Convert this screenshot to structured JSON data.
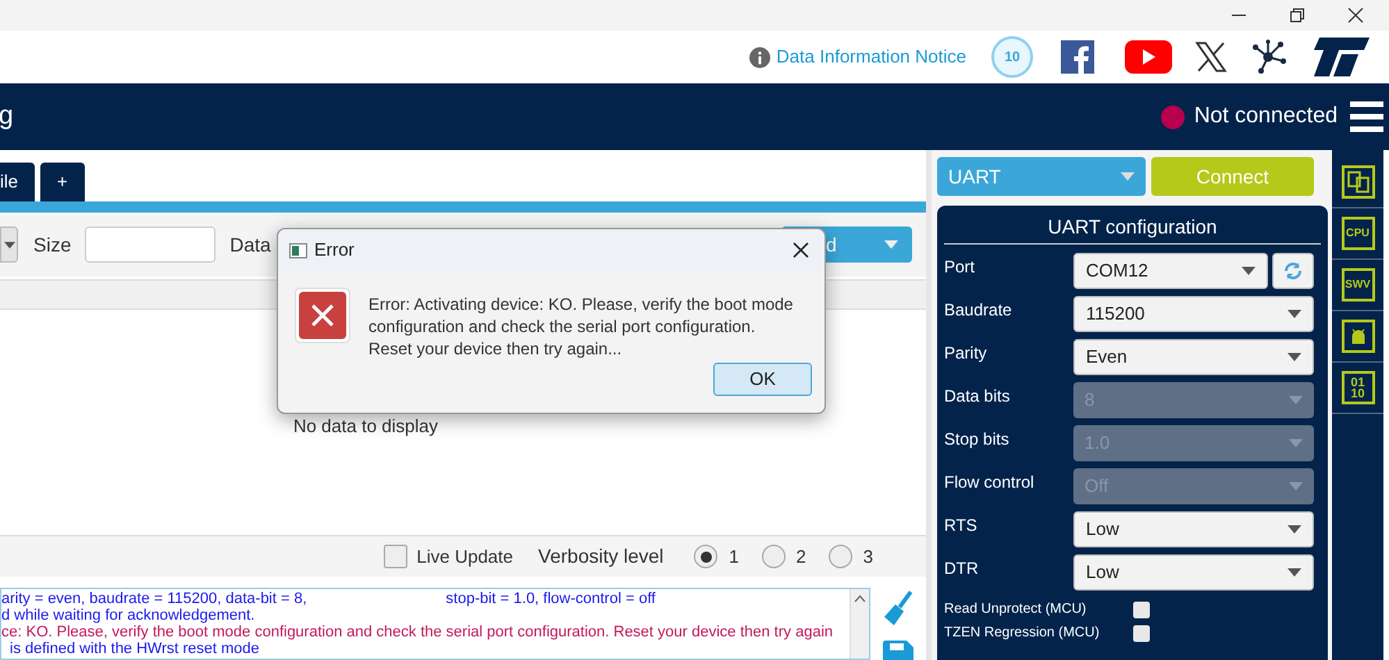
{
  "header": {
    "info_link": "Data Information Notice",
    "anniversary_badge": "10"
  },
  "appbar": {
    "title": "g",
    "status": "Not connected",
    "connected": false
  },
  "tabs": [
    {
      "label": "ile",
      "selected": false
    },
    {
      "label": "+",
      "selected": false
    }
  ],
  "toolbar": {
    "size_label": "Size",
    "data_label": "Data",
    "read_button": "d"
  },
  "table": {
    "empty": "No data to display"
  },
  "dialog": {
    "title": "Error",
    "message": "Error: Activating device: KO. Please, verify the boot mode configuration and check the serial port configuration. Reset your device then try again...",
    "ok": "OK"
  },
  "log_controls": {
    "live_update": {
      "label": "Live Update",
      "checked": false
    },
    "verbosity_label": "Verbosity level",
    "levels": [
      {
        "label": "1",
        "selected": true
      },
      {
        "label": "2",
        "selected": false
      },
      {
        "label": "3",
        "selected": false
      }
    ]
  },
  "log": [
    {
      "kind": "info",
      "text": "arity = even, baudrate = 115200, data-bit = 8,",
      "text_2": "stop-bit = 1.0, flow-control = off"
    },
    {
      "kind": "info",
      "text": "d while waiting for acknowledgement."
    },
    {
      "kind": "error",
      "text": "ce: KO. Please, verify the boot mode configuration and check the serial port configuration. Reset your device then try again"
    },
    {
      "kind": "info",
      "text": "is defined with the HWrst reset mode"
    }
  ],
  "connection": {
    "interface": "UART",
    "connect": "Connect"
  },
  "config": {
    "title": "UART configuration",
    "fields": [
      {
        "label": "Port",
        "value": "COM12",
        "disabled": false,
        "refresh": true
      },
      {
        "label": "Baudrate",
        "value": "115200",
        "disabled": false
      },
      {
        "label": "Parity",
        "value": "Even",
        "disabled": false
      },
      {
        "label": "Data bits",
        "value": "8",
        "disabled": true
      },
      {
        "label": "Stop bits",
        "value": "1.0",
        "disabled": true
      },
      {
        "label": "Flow control",
        "value": "Off",
        "disabled": true
      },
      {
        "label": "RTS",
        "value": "Low",
        "disabled": false
      },
      {
        "label": "DTR",
        "value": "Low",
        "disabled": false
      }
    ],
    "options": [
      {
        "label": "Read Unprotect (MCU)",
        "checked": false
      },
      {
        "label": "TZEN Regression (MCU)",
        "checked": false
      }
    ]
  },
  "sidebar": [
    {
      "kind": "memory"
    },
    {
      "kind": "cpu",
      "label": "CPU"
    },
    {
      "kind": "swv",
      "label": "SWV"
    },
    {
      "kind": "bug"
    },
    {
      "kind": "binary",
      "label": "01\n10"
    }
  ]
}
